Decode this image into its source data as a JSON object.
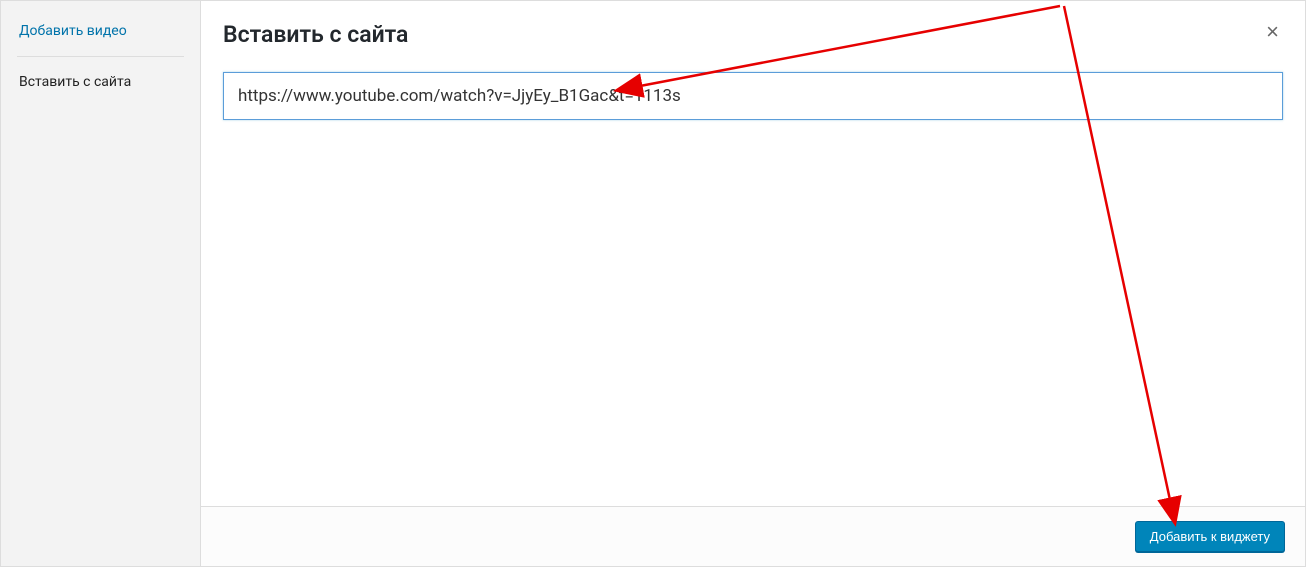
{
  "sidebar": {
    "items": [
      {
        "label": "Добавить видео"
      },
      {
        "label": "Вставить с сайта"
      }
    ]
  },
  "header": {
    "title": "Вставить с сайта"
  },
  "input": {
    "value": "https://www.youtube.com/watch?v=JjyEy_B1Gac&t=1113s"
  },
  "footer": {
    "button_label": "Добавить к виджету"
  }
}
